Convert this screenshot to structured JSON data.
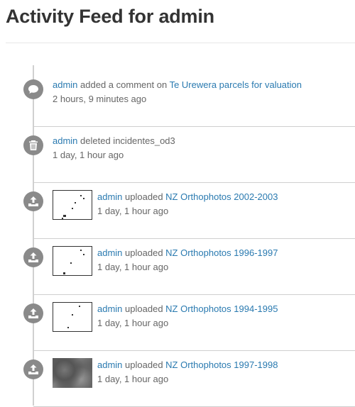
{
  "page": {
    "title": "Activity Feed for admin"
  },
  "activities": [
    {
      "icon": "comment-icon",
      "actor": "admin",
      "action": "added a comment on",
      "target": "Te Urewera parcels for valuation",
      "time": "2 hours, 9 minutes ago"
    },
    {
      "icon": "trash-icon",
      "actor": "admin",
      "action": "deleted incidentes_od3",
      "target": "",
      "time": "1 day, 1 hour ago"
    },
    {
      "icon": "upload-icon",
      "actor": "admin",
      "action": "uploaded",
      "target": "NZ Orthophotos 2002-2003",
      "time": "1 day, 1 hour ago"
    },
    {
      "icon": "upload-icon",
      "actor": "admin",
      "action": "uploaded",
      "target": "NZ Orthophotos 1996-1997",
      "time": "1 day, 1 hour ago"
    },
    {
      "icon": "upload-icon",
      "actor": "admin",
      "action": "uploaded",
      "target": "NZ Orthophotos 1994-1995",
      "time": "1 day, 1 hour ago"
    },
    {
      "icon": "upload-icon",
      "actor": "admin",
      "action": "uploaded",
      "target": "NZ Orthophotos 1997-1998",
      "time": "1 day, 1 hour ago"
    }
  ]
}
